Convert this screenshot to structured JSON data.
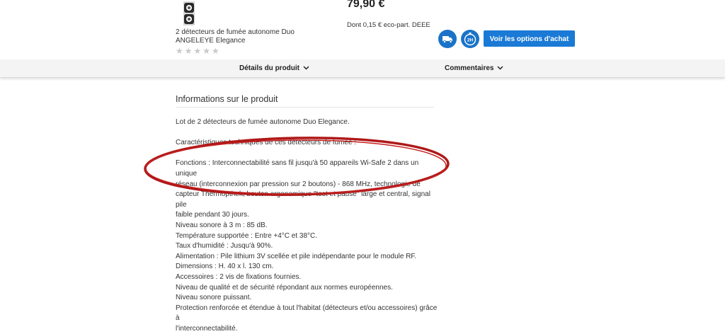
{
  "product": {
    "name_line1": "2 détecteurs de fumée autonome Duo",
    "name_line2": "ANGELEYE Elegance",
    "rating_stars": "★★★★★",
    "rating_value": 0,
    "price": "79,90 €",
    "eco_part": "Dont 0,15 € eco-part. DEEE"
  },
  "actions": {
    "delivery_icon": "truck-icon",
    "express_icon": "2h-clock-icon",
    "options_label": "Voir les options d'achat"
  },
  "tabs": {
    "details_label": "Détails du produit",
    "comments_label": "Commentaires"
  },
  "info": {
    "title": "Informations sur le produit",
    "intro": "Lot de 2 détecteurs de fumée autonome Duo Elegance.",
    "specs_heading": "Caractéristiques techniques de ces détecteurs de fumée :",
    "lines": [
      "Fonctions : Interconnectabilité sans fil jusqu'à 50 appareils Wi-Safe 2 dans un unique",
      "réseau (interconnexion par pression sur 2 boutons) - 868 MHz, technologie de",
      "capteur Thermopthek, bouton ergonomique \"test et pause\" large et central, signal pile",
      "faible pendant 30 jours.",
      "Niveau sonore à 3 m : 85 dB.",
      "Température supportée : Entre +4°C et 38°C.",
      "Taux d'humidité : Jusqu'à 90%.",
      "Alimentation : Pile lithium 3V scellée et pile indépendante pour le module RF.",
      "Dimensions : H. 40 x l. 130 cm.",
      "Accessoires : 2 vis de fixations fournies.",
      "Niveau de qualité et de sécurité répondant aux normes européennes.",
      "Niveau sonore puissant.",
      "Protection renforcée et étendue à tout l'habitat (détecteurs et/ou accessoires) grâce à",
      "l'interconnectabilité."
    ]
  },
  "colors": {
    "accent_blue": "#1a7ad6",
    "annotation_red": "#b01818"
  }
}
